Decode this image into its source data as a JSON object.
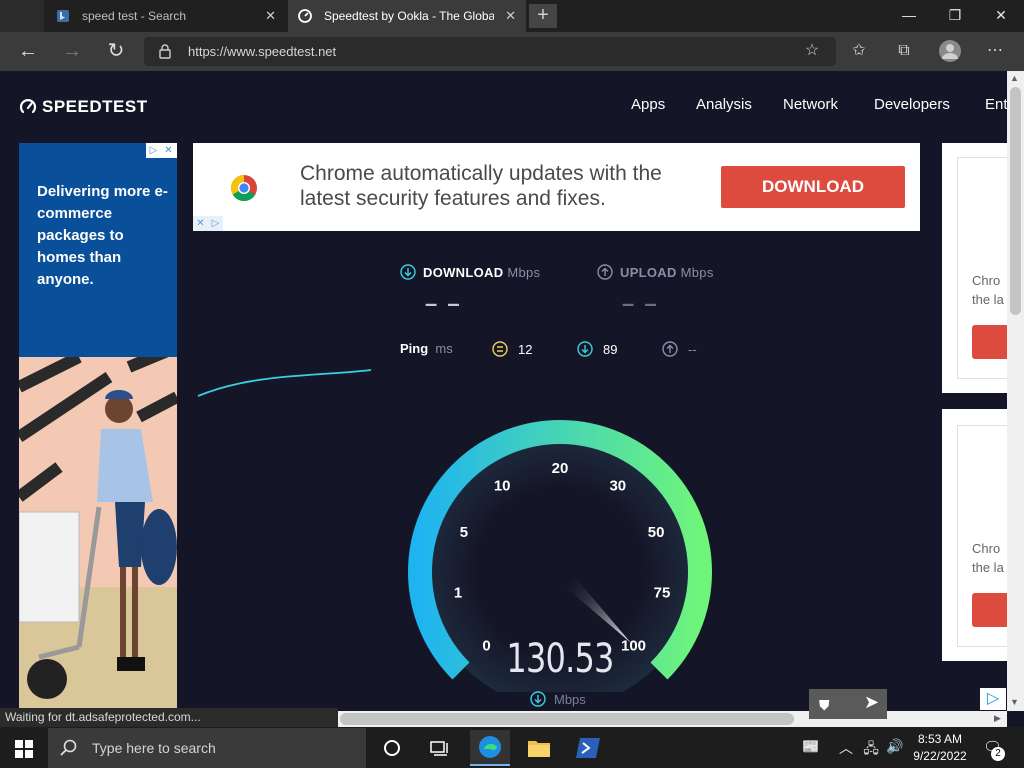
{
  "browser": {
    "tabs": [
      {
        "title": "speed test - Search",
        "active": false
      },
      {
        "title": "Speedtest by Ookla - The Global",
        "active": true
      }
    ],
    "new_tab": "+",
    "window_controls": {
      "minimize": "—",
      "restore": "❐",
      "close": "✕"
    },
    "url": "https://www.speedtest.net",
    "status": "Waiting for dt.adsafeprotected.com..."
  },
  "site": {
    "logo": "SPEEDTEST",
    "nav": [
      "Apps",
      "Analysis",
      "Network",
      "Developers",
      "Ent"
    ]
  },
  "ads": {
    "left": {
      "text": "Delivering more e-commerce packages to homes than anyone."
    },
    "banner": {
      "text": "Chrome automatically updates with the latest security features and fixes.",
      "button": "DOWNLOAD"
    },
    "right1": {
      "text1": "Chro",
      "text2": "the la"
    },
    "right2": {
      "text1": "Chro",
      "text2": "the la"
    }
  },
  "speedtest": {
    "download_label": "DOWNLOAD",
    "upload_label": "UPLOAD",
    "unit_label": "Mbps",
    "download_value": "– –",
    "upload_value": "– –",
    "ping_label": "Ping",
    "ping_unit": "ms",
    "ping_idle": "12",
    "ping_download": "89",
    "ping_upload": "--",
    "gauge_ticks": [
      "0",
      "1",
      "5",
      "10",
      "20",
      "30",
      "50",
      "75",
      "100"
    ],
    "current_speed": "130.53",
    "speed_unit": "Mbps",
    "needle_value": 100
  },
  "taskbar": {
    "search_placeholder": "Type here to search",
    "time": "8:53 AM",
    "date": "9/22/2022",
    "notifications": "2"
  },
  "colors": {
    "page_bg": "#141526",
    "gauge_start": "#1fb4f0",
    "gauge_end": "#6ff57a",
    "ad_red": "#dc4b3e"
  }
}
